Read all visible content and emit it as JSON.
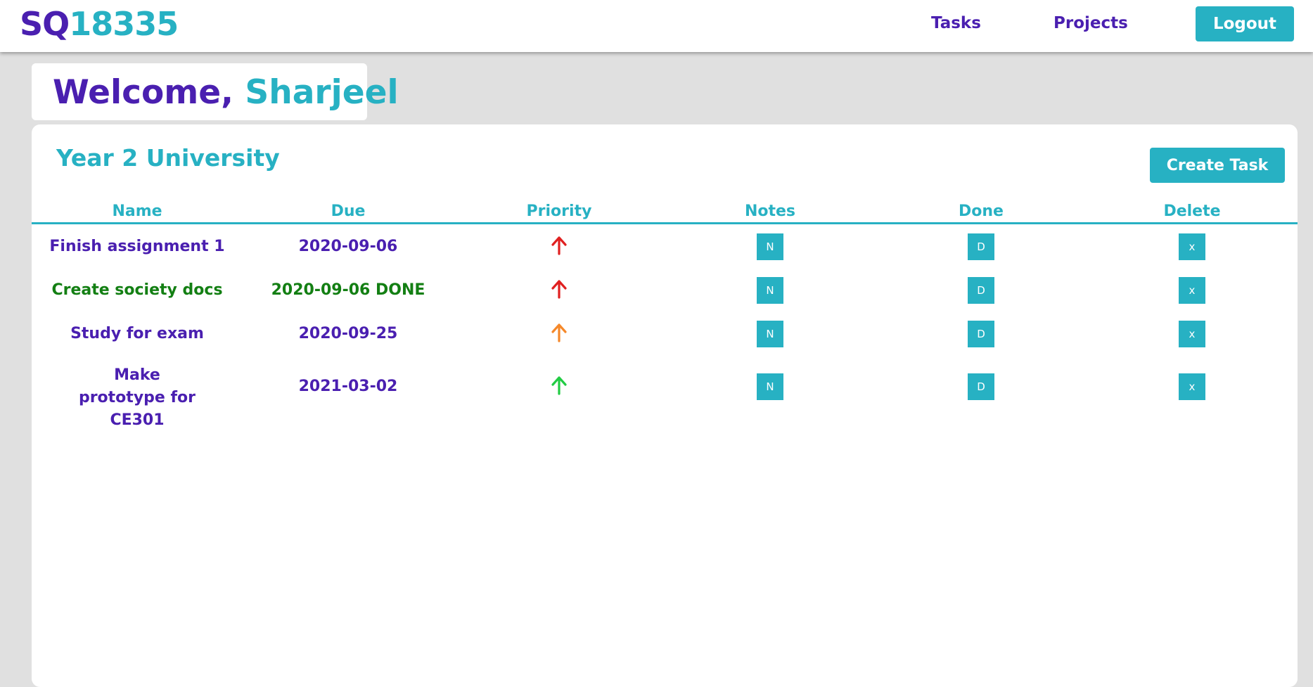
{
  "navbar": {
    "brand_prefix": "SQ",
    "brand_number": "18335",
    "links": [
      "Tasks",
      "Projects"
    ],
    "logout_label": "Logout"
  },
  "welcome": {
    "greeting": "Welcome,",
    "user_name": "Sharjeel"
  },
  "project": {
    "title": "Year 2 University",
    "create_label": "Create Task",
    "columns": [
      "Name",
      "Due",
      "Priority",
      "Notes",
      "Done",
      "Delete"
    ],
    "tasks": [
      {
        "name": "Finish assignment 1",
        "due": "2020-09-06",
        "priority": "high",
        "priority_color": "#e02020",
        "status": "open",
        "notes_label": "N",
        "done_label": "D",
        "delete_label": "x"
      },
      {
        "name": "Create society docs",
        "due": "2020-09-06 DONE",
        "priority": "high",
        "priority_color": "#e02020",
        "status": "done",
        "notes_label": "N",
        "done_label": "D",
        "delete_label": "x"
      },
      {
        "name": "Study for exam",
        "due": "2020-09-25",
        "priority": "medium",
        "priority_color": "#f5882a",
        "status": "open",
        "notes_label": "N",
        "done_label": "D",
        "delete_label": "x"
      },
      {
        "name": "Make prototype for CE301",
        "due": "2021-03-02",
        "priority": "low",
        "priority_color": "#22cc44",
        "status": "open",
        "notes_label": "N",
        "done_label": "D",
        "delete_label": "x"
      }
    ]
  },
  "colors": {
    "primary_purple": "#4a1fb0",
    "accent_teal": "#27b1c3",
    "done_green": "#137f13",
    "page_background": "#e0e0e0"
  }
}
